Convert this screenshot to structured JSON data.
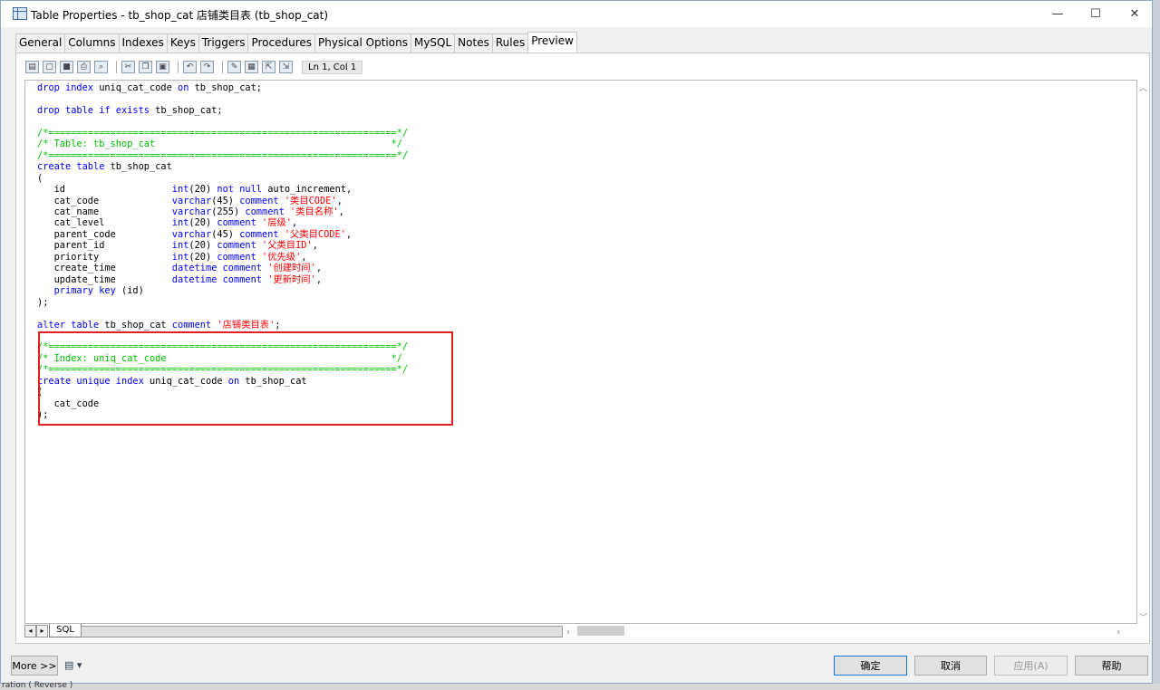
{
  "window": {
    "title": "Table Properties - tb_shop_cat 店铺类目表 (tb_shop_cat)",
    "minimize": "—",
    "maximize": "☐",
    "close": "✕"
  },
  "tabs": [
    {
      "label": "General"
    },
    {
      "label": "Columns"
    },
    {
      "label": "Indexes"
    },
    {
      "label": "Keys"
    },
    {
      "label": "Triggers"
    },
    {
      "label": "Procedures"
    },
    {
      "label": "Physical Options"
    },
    {
      "label": "MySQL"
    },
    {
      "label": "Notes"
    },
    {
      "label": "Rules"
    },
    {
      "label": "Preview"
    }
  ],
  "toolbar": {
    "icons": [
      "properties-icon",
      "new-icon",
      "save-icon",
      "print-icon",
      "find-icon",
      "cut-icon",
      "copy-icon",
      "paste-icon",
      "undo-icon",
      "redo-icon",
      "edit-icon",
      "table-icon",
      "export-icon",
      "import-icon"
    ],
    "position": "Ln 1, Col 1"
  },
  "sql_lines": [
    [
      {
        "t": "drop index",
        "c": "k"
      },
      {
        "t": " uniq_cat_code "
      },
      {
        "t": "on",
        "c": "k"
      },
      {
        "t": " tb_shop_cat;"
      }
    ],
    [],
    [
      {
        "t": "drop table if exists",
        "c": "k"
      },
      {
        "t": " tb_shop_cat;"
      }
    ],
    [],
    [
      {
        "t": "/*==============================================================*/",
        "c": "c"
      }
    ],
    [
      {
        "t": "/* Table: tb_shop_cat                                          */",
        "c": "c"
      }
    ],
    [
      {
        "t": "/*==============================================================*/",
        "c": "c"
      }
    ],
    [
      {
        "t": "create table",
        "c": "k"
      },
      {
        "t": " tb_shop_cat"
      }
    ],
    [
      {
        "t": "("
      }
    ],
    [
      {
        "t": "   id                   "
      },
      {
        "t": "int",
        "c": "k"
      },
      {
        "t": "(20) "
      },
      {
        "t": "not null",
        "c": "k"
      },
      {
        "t": " auto_increment,"
      }
    ],
    [
      {
        "t": "   cat_code             "
      },
      {
        "t": "varchar",
        "c": "k"
      },
      {
        "t": "(45) "
      },
      {
        "t": "comment",
        "c": "k"
      },
      {
        "t": " "
      },
      {
        "t": "'类目CODE'",
        "c": "s"
      },
      {
        "t": ","
      }
    ],
    [
      {
        "t": "   cat_name             "
      },
      {
        "t": "varchar",
        "c": "k"
      },
      {
        "t": "(255) "
      },
      {
        "t": "comment",
        "c": "k"
      },
      {
        "t": " "
      },
      {
        "t": "'类目名称'",
        "c": "s"
      },
      {
        "t": ","
      }
    ],
    [
      {
        "t": "   cat_level            "
      },
      {
        "t": "int",
        "c": "k"
      },
      {
        "t": "(20) "
      },
      {
        "t": "comment",
        "c": "k"
      },
      {
        "t": " "
      },
      {
        "t": "'层级'",
        "c": "s"
      },
      {
        "t": ","
      }
    ],
    [
      {
        "t": "   parent_code          "
      },
      {
        "t": "varchar",
        "c": "k"
      },
      {
        "t": "(45) "
      },
      {
        "t": "comment",
        "c": "k"
      },
      {
        "t": " "
      },
      {
        "t": "'父类目CODE'",
        "c": "s"
      },
      {
        "t": ","
      }
    ],
    [
      {
        "t": "   parent_id            "
      },
      {
        "t": "int",
        "c": "k"
      },
      {
        "t": "(20) "
      },
      {
        "t": "comment",
        "c": "k"
      },
      {
        "t": " "
      },
      {
        "t": "'父类目ID'",
        "c": "s"
      },
      {
        "t": ","
      }
    ],
    [
      {
        "t": "   priority             "
      },
      {
        "t": "int",
        "c": "k"
      },
      {
        "t": "(20) "
      },
      {
        "t": "comment",
        "c": "k"
      },
      {
        "t": " "
      },
      {
        "t": "'优先级'",
        "c": "s"
      },
      {
        "t": ","
      }
    ],
    [
      {
        "t": "   create_time          "
      },
      {
        "t": "datetime",
        "c": "k"
      },
      {
        "t": " "
      },
      {
        "t": "comment",
        "c": "k"
      },
      {
        "t": " "
      },
      {
        "t": "'创建时间'",
        "c": "s"
      },
      {
        "t": ","
      }
    ],
    [
      {
        "t": "   update_time          "
      },
      {
        "t": "datetime",
        "c": "k"
      },
      {
        "t": " "
      },
      {
        "t": "comment",
        "c": "k"
      },
      {
        "t": " "
      },
      {
        "t": "'更新时间'",
        "c": "s"
      },
      {
        "t": ","
      }
    ],
    [
      {
        "t": "   "
      },
      {
        "t": "primary key",
        "c": "k"
      },
      {
        "t": " (id)"
      }
    ],
    [
      {
        "t": ");"
      }
    ],
    [],
    [
      {
        "t": "alter table",
        "c": "k"
      },
      {
        "t": " tb_shop_cat "
      },
      {
        "t": "comment",
        "c": "k"
      },
      {
        "t": " "
      },
      {
        "t": "'店铺类目表'",
        "c": "s"
      },
      {
        "t": ";"
      }
    ],
    [],
    [
      {
        "t": "/*==============================================================*/",
        "c": "c"
      }
    ],
    [
      {
        "t": "/* Index: uniq_cat_code                                        */",
        "c": "c"
      }
    ],
    [
      {
        "t": "/*==============================================================*/",
        "c": "c"
      }
    ],
    [
      {
        "t": "create unique index",
        "c": "k"
      },
      {
        "t": " uniq_cat_code "
      },
      {
        "t": "on",
        "c": "k"
      },
      {
        "t": " tb_shop_cat"
      }
    ],
    [
      {
        "t": "("
      }
    ],
    [
      {
        "t": "   cat_code"
      }
    ],
    [
      {
        "t": ");"
      }
    ]
  ],
  "sheet_tab": "SQL",
  "buttons": {
    "more": "More >>",
    "ok": "确定",
    "cancel": "取消",
    "apply": "应用(A)",
    "help": "帮助"
  },
  "background_fragment": "ration ( Reverse )"
}
